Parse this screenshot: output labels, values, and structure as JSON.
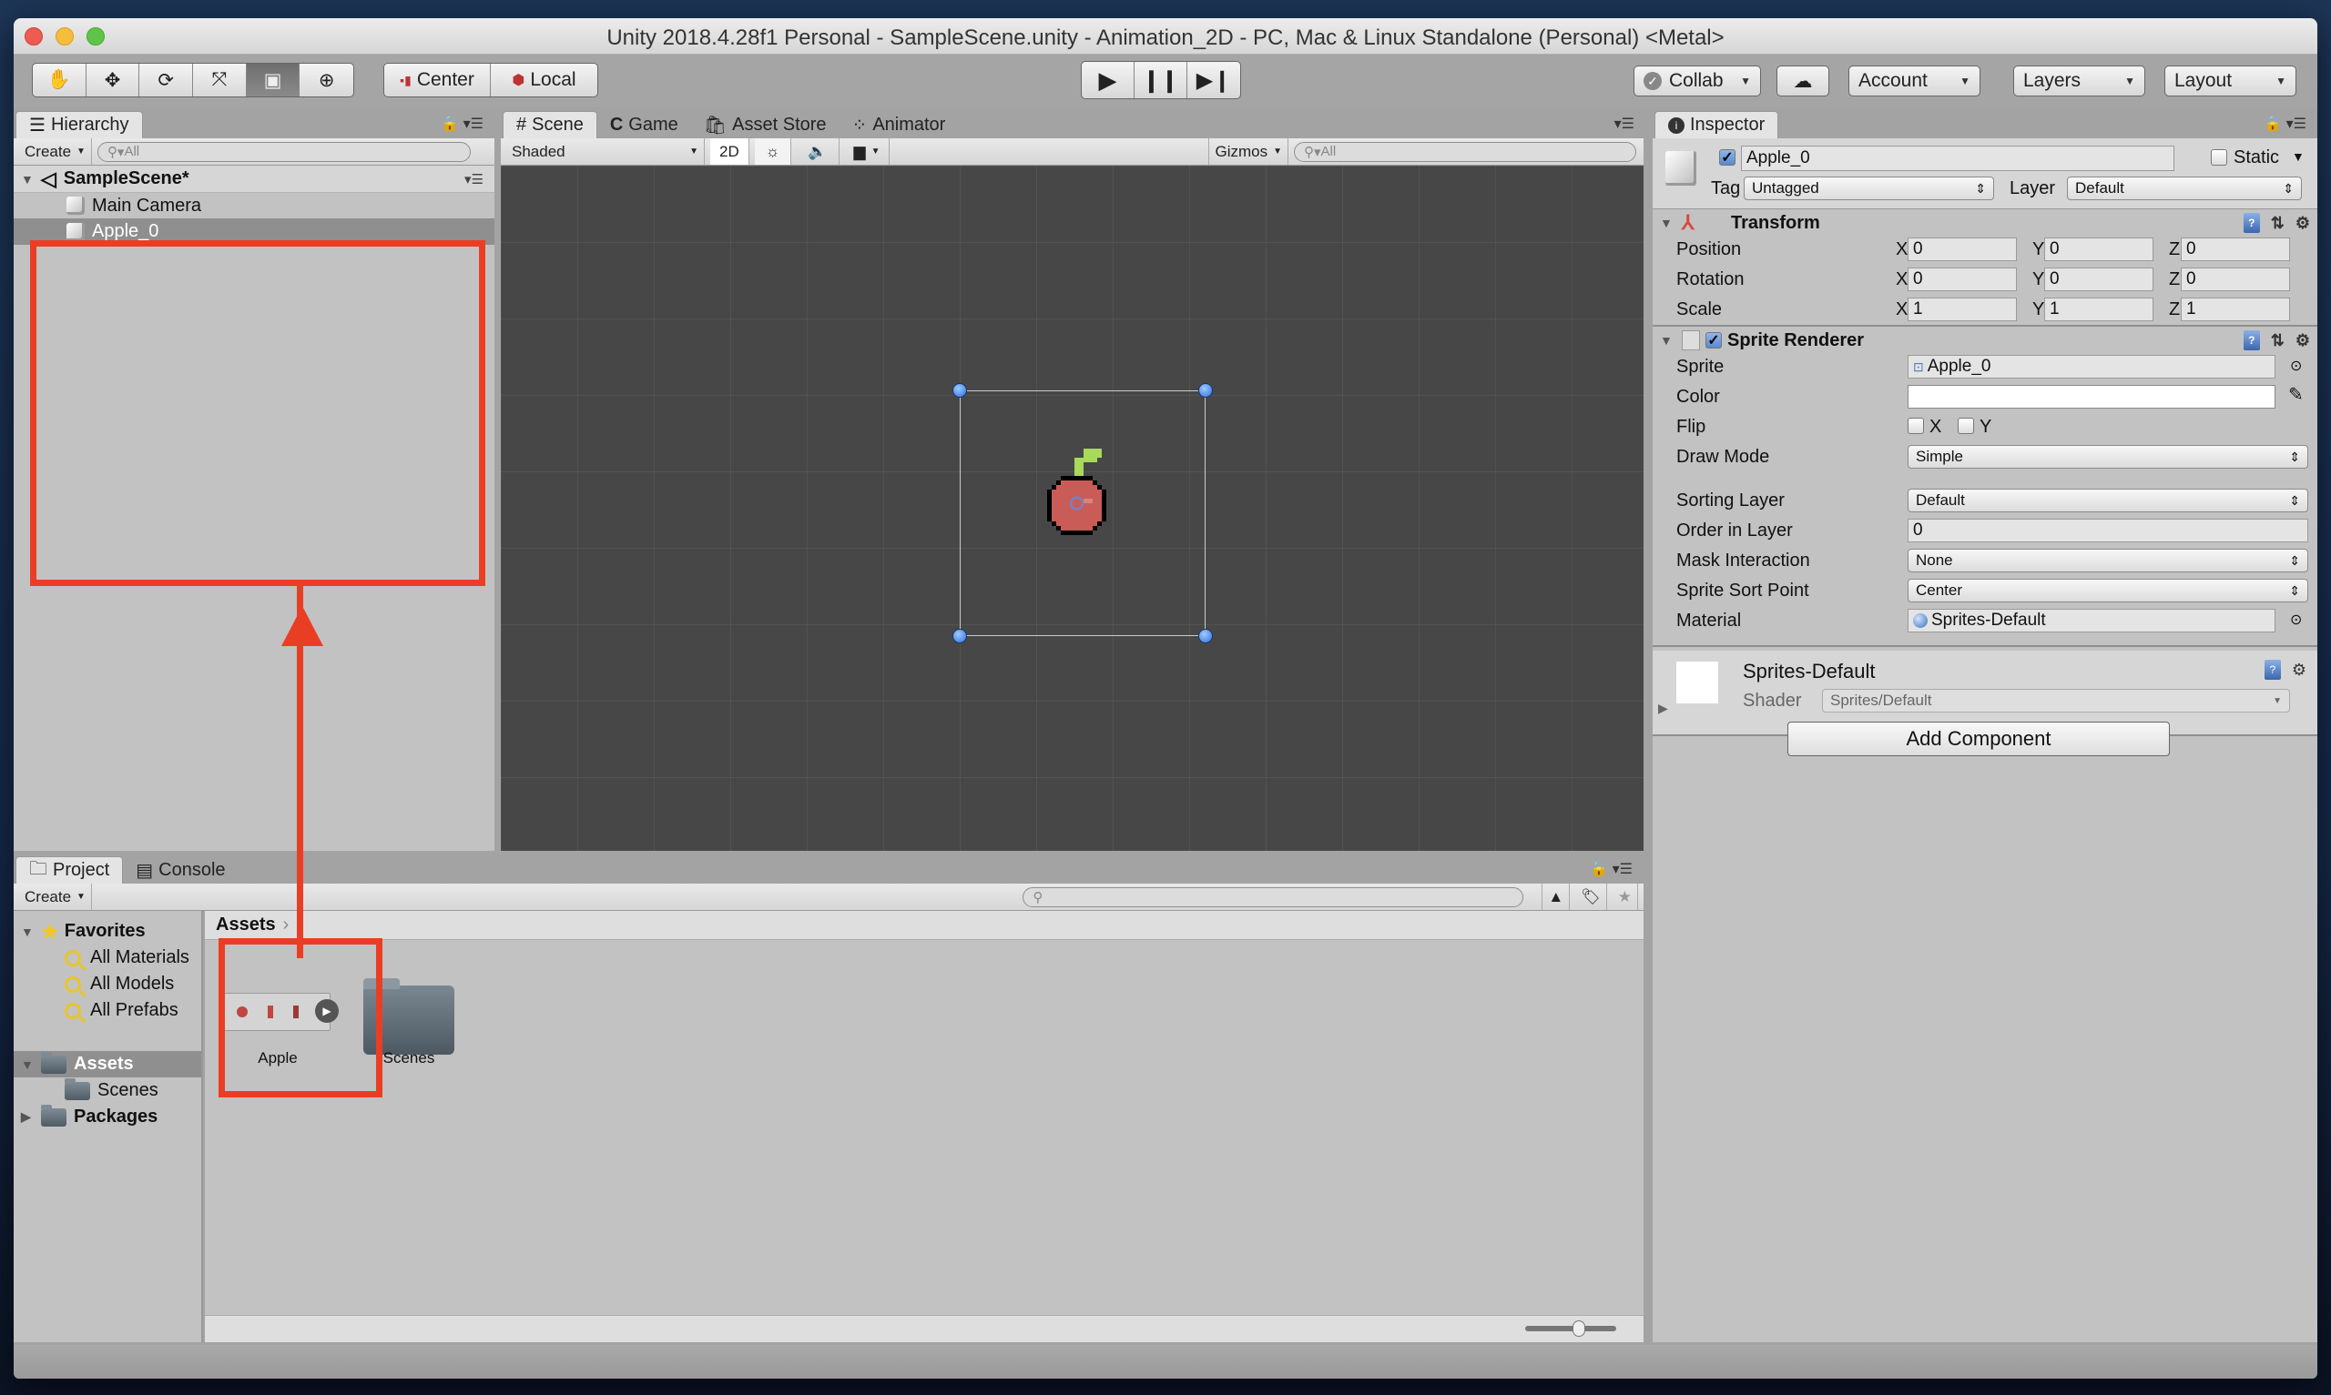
{
  "window": {
    "title": "Unity 2018.4.28f1 Personal - SampleScene.unity - Animation_2D - PC, Mac & Linux Standalone (Personal) <Metal>"
  },
  "toolbar": {
    "tools": [
      "hand-tool",
      "move-tool",
      "rotate-tool",
      "scale-tool",
      "rect-tool",
      "transform-tool"
    ],
    "active_tool": "rect-tool",
    "pivot_label": "Center",
    "space_label": "Local",
    "collab_label": "Collab",
    "account_label": "Account",
    "layers_label": "Layers",
    "layout_label": "Layout"
  },
  "hierarchy": {
    "tab_label": "Hierarchy",
    "create_label": "Create",
    "search_placeholder": "All",
    "scene_name": "SampleScene*",
    "items": [
      {
        "label": "Main Camera",
        "selected": false
      },
      {
        "label": "Apple_0",
        "selected": true
      }
    ]
  },
  "scene_tabs": {
    "tabs": [
      {
        "label": "Scene",
        "active": true
      },
      {
        "label": "Game",
        "active": false
      },
      {
        "label": "Asset Store",
        "active": false
      },
      {
        "label": "Animator",
        "active": false
      }
    ],
    "shading_mode": "Shaded",
    "mode_2d": "2D",
    "gizmos_label": "Gizmos",
    "search_placeholder": "All"
  },
  "inspector": {
    "tab_label": "Inspector",
    "object_name": "Apple_0",
    "object_active": true,
    "static_label": "Static",
    "tag_label": "Tag",
    "tag_value": "Untagged",
    "layer_label": "Layer",
    "layer_value": "Default",
    "transform": {
      "title": "Transform",
      "rows": [
        {
          "label": "Position",
          "x": "0",
          "y": "0",
          "z": "0"
        },
        {
          "label": "Rotation",
          "x": "0",
          "y": "0",
          "z": "0"
        },
        {
          "label": "Scale",
          "x": "1",
          "y": "1",
          "z": "1"
        }
      ],
      "axis_x": "X",
      "axis_y": "Y",
      "axis_z": "Z"
    },
    "sprite_renderer": {
      "title": "Sprite Renderer",
      "enabled": true,
      "sprite_label": "Sprite",
      "sprite_value": "Apple_0",
      "color_label": "Color",
      "color_value": "#ffffff",
      "flip_label": "Flip",
      "flip_x": "X",
      "flip_y": "Y",
      "draw_mode_label": "Draw Mode",
      "draw_mode_value": "Simple",
      "sorting_layer_label": "Sorting Layer",
      "sorting_layer_value": "Default",
      "order_label": "Order in Layer",
      "order_value": "0",
      "mask_label": "Mask Interaction",
      "mask_value": "None",
      "sort_point_label": "Sprite Sort Point",
      "sort_point_value": "Center",
      "material_label": "Material",
      "material_value": "Sprites-Default"
    },
    "material": {
      "name": "Sprites-Default",
      "shader_label": "Shader",
      "shader_value": "Sprites/Default"
    },
    "add_component_label": "Add Component"
  },
  "project": {
    "tabs": [
      {
        "label": "Project",
        "active": true
      },
      {
        "label": "Console",
        "active": false
      }
    ],
    "create_label": "Create",
    "favorites_label": "Favorites",
    "favorites": [
      "All Materials",
      "All Models",
      "All Prefabs"
    ],
    "assets_label": "Assets",
    "asset_children": [
      "Scenes"
    ],
    "packages_label": "Packages",
    "breadcrumb": "Assets",
    "grid_items": [
      {
        "label": "Apple",
        "type": "animation-sprite"
      },
      {
        "label": "Scenes",
        "type": "folder"
      }
    ]
  },
  "annotation": {
    "color": "#ea3e24"
  }
}
